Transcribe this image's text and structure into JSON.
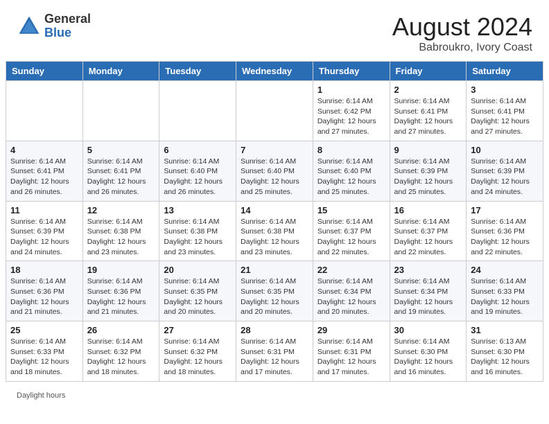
{
  "header": {
    "logo_general": "General",
    "logo_blue": "Blue",
    "month_year": "August 2024",
    "location": "Babroukro, Ivory Coast"
  },
  "days_of_week": [
    "Sunday",
    "Monday",
    "Tuesday",
    "Wednesday",
    "Thursday",
    "Friday",
    "Saturday"
  ],
  "footer": {
    "daylight_hours": "Daylight hours"
  },
  "weeks": [
    [
      {
        "day": "",
        "info": ""
      },
      {
        "day": "",
        "info": ""
      },
      {
        "day": "",
        "info": ""
      },
      {
        "day": "",
        "info": ""
      },
      {
        "day": "1",
        "info": "Sunrise: 6:14 AM\nSunset: 6:42 PM\nDaylight: 12 hours\nand 27 minutes."
      },
      {
        "day": "2",
        "info": "Sunrise: 6:14 AM\nSunset: 6:41 PM\nDaylight: 12 hours\nand 27 minutes."
      },
      {
        "day": "3",
        "info": "Sunrise: 6:14 AM\nSunset: 6:41 PM\nDaylight: 12 hours\nand 27 minutes."
      }
    ],
    [
      {
        "day": "4",
        "info": "Sunrise: 6:14 AM\nSunset: 6:41 PM\nDaylight: 12 hours\nand 26 minutes."
      },
      {
        "day": "5",
        "info": "Sunrise: 6:14 AM\nSunset: 6:41 PM\nDaylight: 12 hours\nand 26 minutes."
      },
      {
        "day": "6",
        "info": "Sunrise: 6:14 AM\nSunset: 6:40 PM\nDaylight: 12 hours\nand 26 minutes."
      },
      {
        "day": "7",
        "info": "Sunrise: 6:14 AM\nSunset: 6:40 PM\nDaylight: 12 hours\nand 25 minutes."
      },
      {
        "day": "8",
        "info": "Sunrise: 6:14 AM\nSunset: 6:40 PM\nDaylight: 12 hours\nand 25 minutes."
      },
      {
        "day": "9",
        "info": "Sunrise: 6:14 AM\nSunset: 6:39 PM\nDaylight: 12 hours\nand 25 minutes."
      },
      {
        "day": "10",
        "info": "Sunrise: 6:14 AM\nSunset: 6:39 PM\nDaylight: 12 hours\nand 24 minutes."
      }
    ],
    [
      {
        "day": "11",
        "info": "Sunrise: 6:14 AM\nSunset: 6:39 PM\nDaylight: 12 hours\nand 24 minutes."
      },
      {
        "day": "12",
        "info": "Sunrise: 6:14 AM\nSunset: 6:38 PM\nDaylight: 12 hours\nand 23 minutes."
      },
      {
        "day": "13",
        "info": "Sunrise: 6:14 AM\nSunset: 6:38 PM\nDaylight: 12 hours\nand 23 minutes."
      },
      {
        "day": "14",
        "info": "Sunrise: 6:14 AM\nSunset: 6:38 PM\nDaylight: 12 hours\nand 23 minutes."
      },
      {
        "day": "15",
        "info": "Sunrise: 6:14 AM\nSunset: 6:37 PM\nDaylight: 12 hours\nand 22 minutes."
      },
      {
        "day": "16",
        "info": "Sunrise: 6:14 AM\nSunset: 6:37 PM\nDaylight: 12 hours\nand 22 minutes."
      },
      {
        "day": "17",
        "info": "Sunrise: 6:14 AM\nSunset: 6:36 PM\nDaylight: 12 hours\nand 22 minutes."
      }
    ],
    [
      {
        "day": "18",
        "info": "Sunrise: 6:14 AM\nSunset: 6:36 PM\nDaylight: 12 hours\nand 21 minutes."
      },
      {
        "day": "19",
        "info": "Sunrise: 6:14 AM\nSunset: 6:36 PM\nDaylight: 12 hours\nand 21 minutes."
      },
      {
        "day": "20",
        "info": "Sunrise: 6:14 AM\nSunset: 6:35 PM\nDaylight: 12 hours\nand 20 minutes."
      },
      {
        "day": "21",
        "info": "Sunrise: 6:14 AM\nSunset: 6:35 PM\nDaylight: 12 hours\nand 20 minutes."
      },
      {
        "day": "22",
        "info": "Sunrise: 6:14 AM\nSunset: 6:34 PM\nDaylight: 12 hours\nand 20 minutes."
      },
      {
        "day": "23",
        "info": "Sunrise: 6:14 AM\nSunset: 6:34 PM\nDaylight: 12 hours\nand 19 minutes."
      },
      {
        "day": "24",
        "info": "Sunrise: 6:14 AM\nSunset: 6:33 PM\nDaylight: 12 hours\nand 19 minutes."
      }
    ],
    [
      {
        "day": "25",
        "info": "Sunrise: 6:14 AM\nSunset: 6:33 PM\nDaylight: 12 hours\nand 18 minutes."
      },
      {
        "day": "26",
        "info": "Sunrise: 6:14 AM\nSunset: 6:32 PM\nDaylight: 12 hours\nand 18 minutes."
      },
      {
        "day": "27",
        "info": "Sunrise: 6:14 AM\nSunset: 6:32 PM\nDaylight: 12 hours\nand 18 minutes."
      },
      {
        "day": "28",
        "info": "Sunrise: 6:14 AM\nSunset: 6:31 PM\nDaylight: 12 hours\nand 17 minutes."
      },
      {
        "day": "29",
        "info": "Sunrise: 6:14 AM\nSunset: 6:31 PM\nDaylight: 12 hours\nand 17 minutes."
      },
      {
        "day": "30",
        "info": "Sunrise: 6:14 AM\nSunset: 6:30 PM\nDaylight: 12 hours\nand 16 minutes."
      },
      {
        "day": "31",
        "info": "Sunrise: 6:13 AM\nSunset: 6:30 PM\nDaylight: 12 hours\nand 16 minutes."
      }
    ]
  ]
}
